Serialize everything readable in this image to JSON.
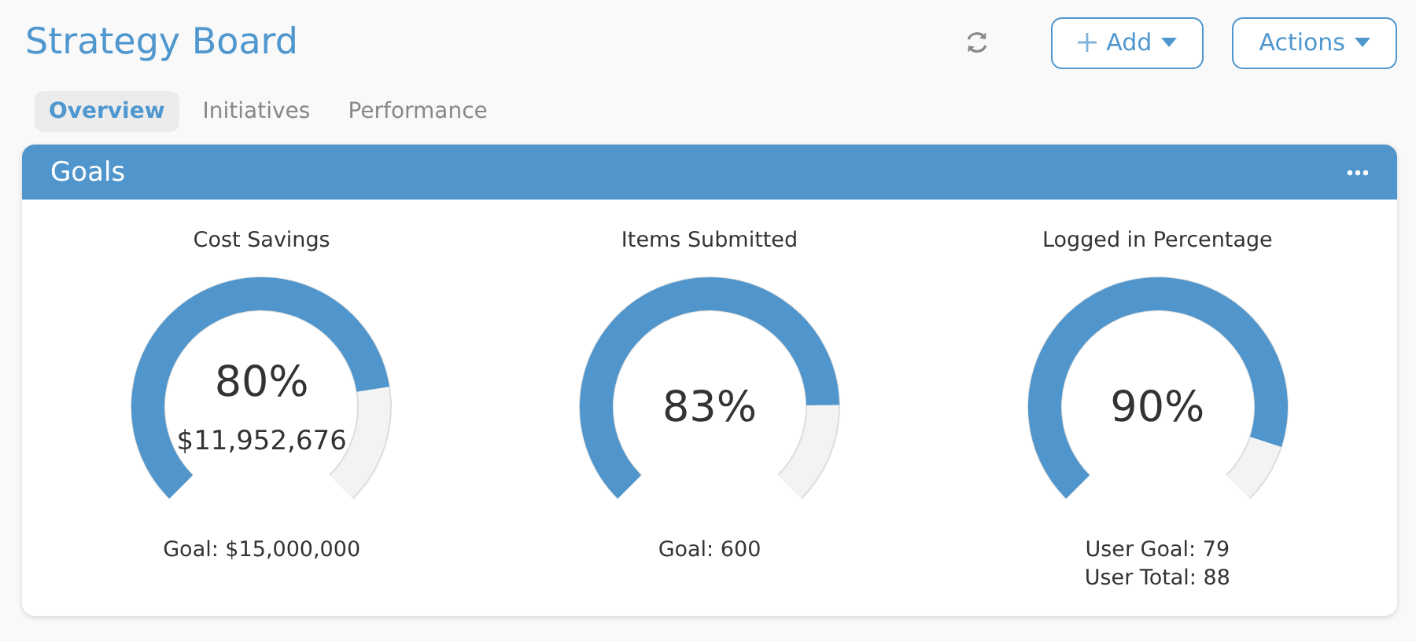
{
  "header": {
    "title": "Strategy Board",
    "buttons": [
      {
        "label": "Add",
        "kind": "add"
      },
      {
        "label": "Actions",
        "kind": "menu"
      }
    ]
  },
  "tabs": [
    {
      "label": "Overview",
      "selected": true
    },
    {
      "label": "Initiatives",
      "selected": false
    },
    {
      "label": "Performance",
      "selected": false
    }
  ],
  "panel": {
    "title": "Goals",
    "gauges": [
      {
        "title": "Cost Savings",
        "percent": "80%",
        "value": "$11,952,676",
        "details": [
          "Goal: $15,000,000"
        ]
      },
      {
        "title": "Items Submitted",
        "percent": "83%",
        "details": [
          "Goal: 600"
        ]
      },
      {
        "title": "Logged in Percentage",
        "percent": "90%",
        "details": [
          "User Goal: 79",
          "User Total: 88"
        ]
      }
    ]
  }
}
